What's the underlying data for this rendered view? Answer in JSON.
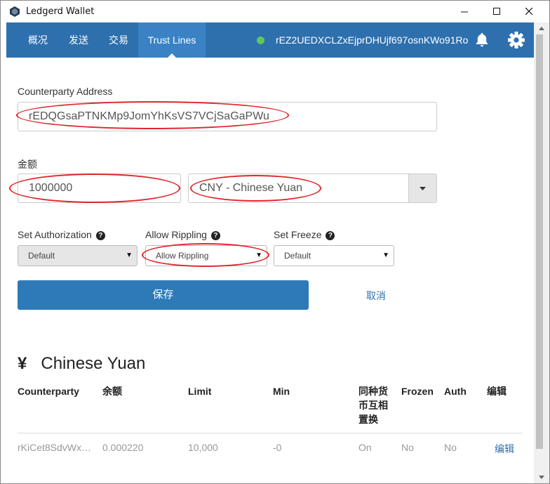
{
  "window": {
    "title": "Ledgerd Wallet"
  },
  "nav": {
    "tabs": [
      {
        "label": "概况"
      },
      {
        "label": "发送"
      },
      {
        "label": "交易"
      },
      {
        "label": "Trust Lines",
        "active": true
      }
    ],
    "account_address": "rEZ2UEDXCLZxEjprDHUjf697osnKWo91Ro",
    "status_color": "#5cc95c"
  },
  "form": {
    "counterparty_label": "Counterparty Address",
    "counterparty_value": "rEDQGsaPTNKMp9JomYhKsVS7VCjSaGaPWu",
    "amount_label": "金额",
    "amount_value": "1000000",
    "currency_value": "CNY - Chinese Yuan",
    "set_authorization_label": "Set Authorization",
    "set_authorization_value": "Default",
    "allow_rippling_label": "Allow Rippling",
    "allow_rippling_value": "Allow Rippling",
    "set_freeze_label": "Set Freeze",
    "set_freeze_value": "Default",
    "save_label": "保存",
    "cancel_label": "取消"
  },
  "trust_lines": {
    "currency_symbol": "¥",
    "currency_name": "Chinese Yuan",
    "columns": [
      "Counterparty",
      "余额",
      "Limit",
      "Min",
      "同种货币互相置换",
      "Frozen",
      "Auth",
      "编辑"
    ],
    "rows": [
      {
        "counterparty": "rKiCet8SdvWx…",
        "balance": "0.000220",
        "limit": "10,000",
        "min": "-0",
        "rippling": "On",
        "frozen": "No",
        "auth": "No",
        "edit": "编辑"
      }
    ]
  },
  "colors": {
    "nav": "#2e6fad",
    "accent": "#2e7ab8",
    "annotation": "#e0262b"
  }
}
